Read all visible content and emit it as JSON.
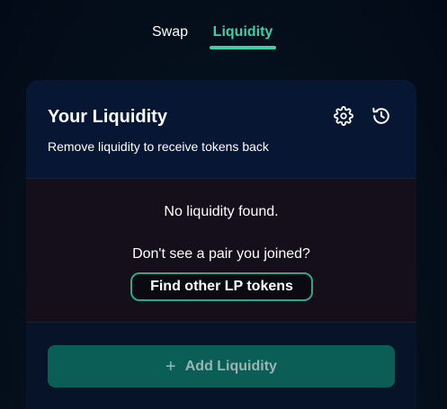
{
  "tabs": {
    "swap_label": "Swap",
    "liquidity_label": "Liquidity",
    "active": "Liquidity"
  },
  "card": {
    "title": "Your Liquidity",
    "subtitle": "Remove liquidity to receive tokens back",
    "icons": [
      "gear-icon",
      "history-icon"
    ],
    "empty_message": "No liquidity found.",
    "hint": "Don't see a pair you joined?",
    "find_button": "Find other LP tokens",
    "add_button": "Add Liquidity",
    "add_button_icon": "+"
  },
  "colors": {
    "accent": "#3ecfa6",
    "add_button_bg": "#0b5e56",
    "card_bg": "#071633"
  }
}
